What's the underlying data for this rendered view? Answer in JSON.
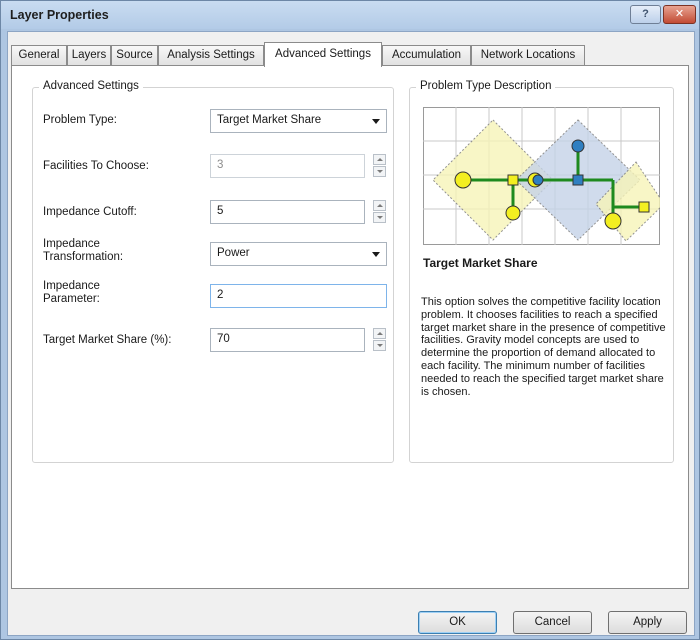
{
  "window": {
    "title": "Layer Properties",
    "help_label": "?",
    "close_label": "✕"
  },
  "tabs": [
    {
      "label": "General"
    },
    {
      "label": "Layers"
    },
    {
      "label": "Source"
    },
    {
      "label": "Analysis Settings"
    },
    {
      "label": "Advanced Settings",
      "active": true
    },
    {
      "label": "Accumulation"
    },
    {
      "label": "Network Locations"
    }
  ],
  "advanced": {
    "legend": "Advanced Settings",
    "problem_type": {
      "label": "Problem Type:",
      "value": "Target Market Share"
    },
    "facilities_to_choose": {
      "label": "Facilities To Choose:",
      "value": "3",
      "enabled": false
    },
    "impedance_cutoff": {
      "label": "Impedance Cutoff:",
      "value": "5"
    },
    "impedance_transformation": {
      "label_line1": "Impedance",
      "label_line2": "Transformation:",
      "value": "Power"
    },
    "impedance_parameter": {
      "label_line1": "Impedance",
      "label_line2": "Parameter:",
      "value": "2"
    },
    "target_market_share": {
      "label": "Target Market Share (%):",
      "value": "70"
    }
  },
  "description": {
    "legend": "Problem Type Description",
    "title": "Target Market Share",
    "text": "This option solves the competitive facility location problem. It chooses facilities to reach a specified target market share in the presence of competitive facilities. Gravity model concepts are used to determine the proportion of demand allocated to each facility. The minimum number of facilities needed to reach the specified target market share is chosen.",
    "diagram_colors": {
      "grid": "#c8c8c8",
      "yellow_area": "#f7f4b8",
      "blue_area": "#c5d3e8",
      "network": "#1e8a1e",
      "facility_yellow": "#f3ef21",
      "facility_blue": "#2f7fc1"
    }
  },
  "buttons": {
    "ok": "OK",
    "cancel": "Cancel",
    "apply": "Apply"
  }
}
